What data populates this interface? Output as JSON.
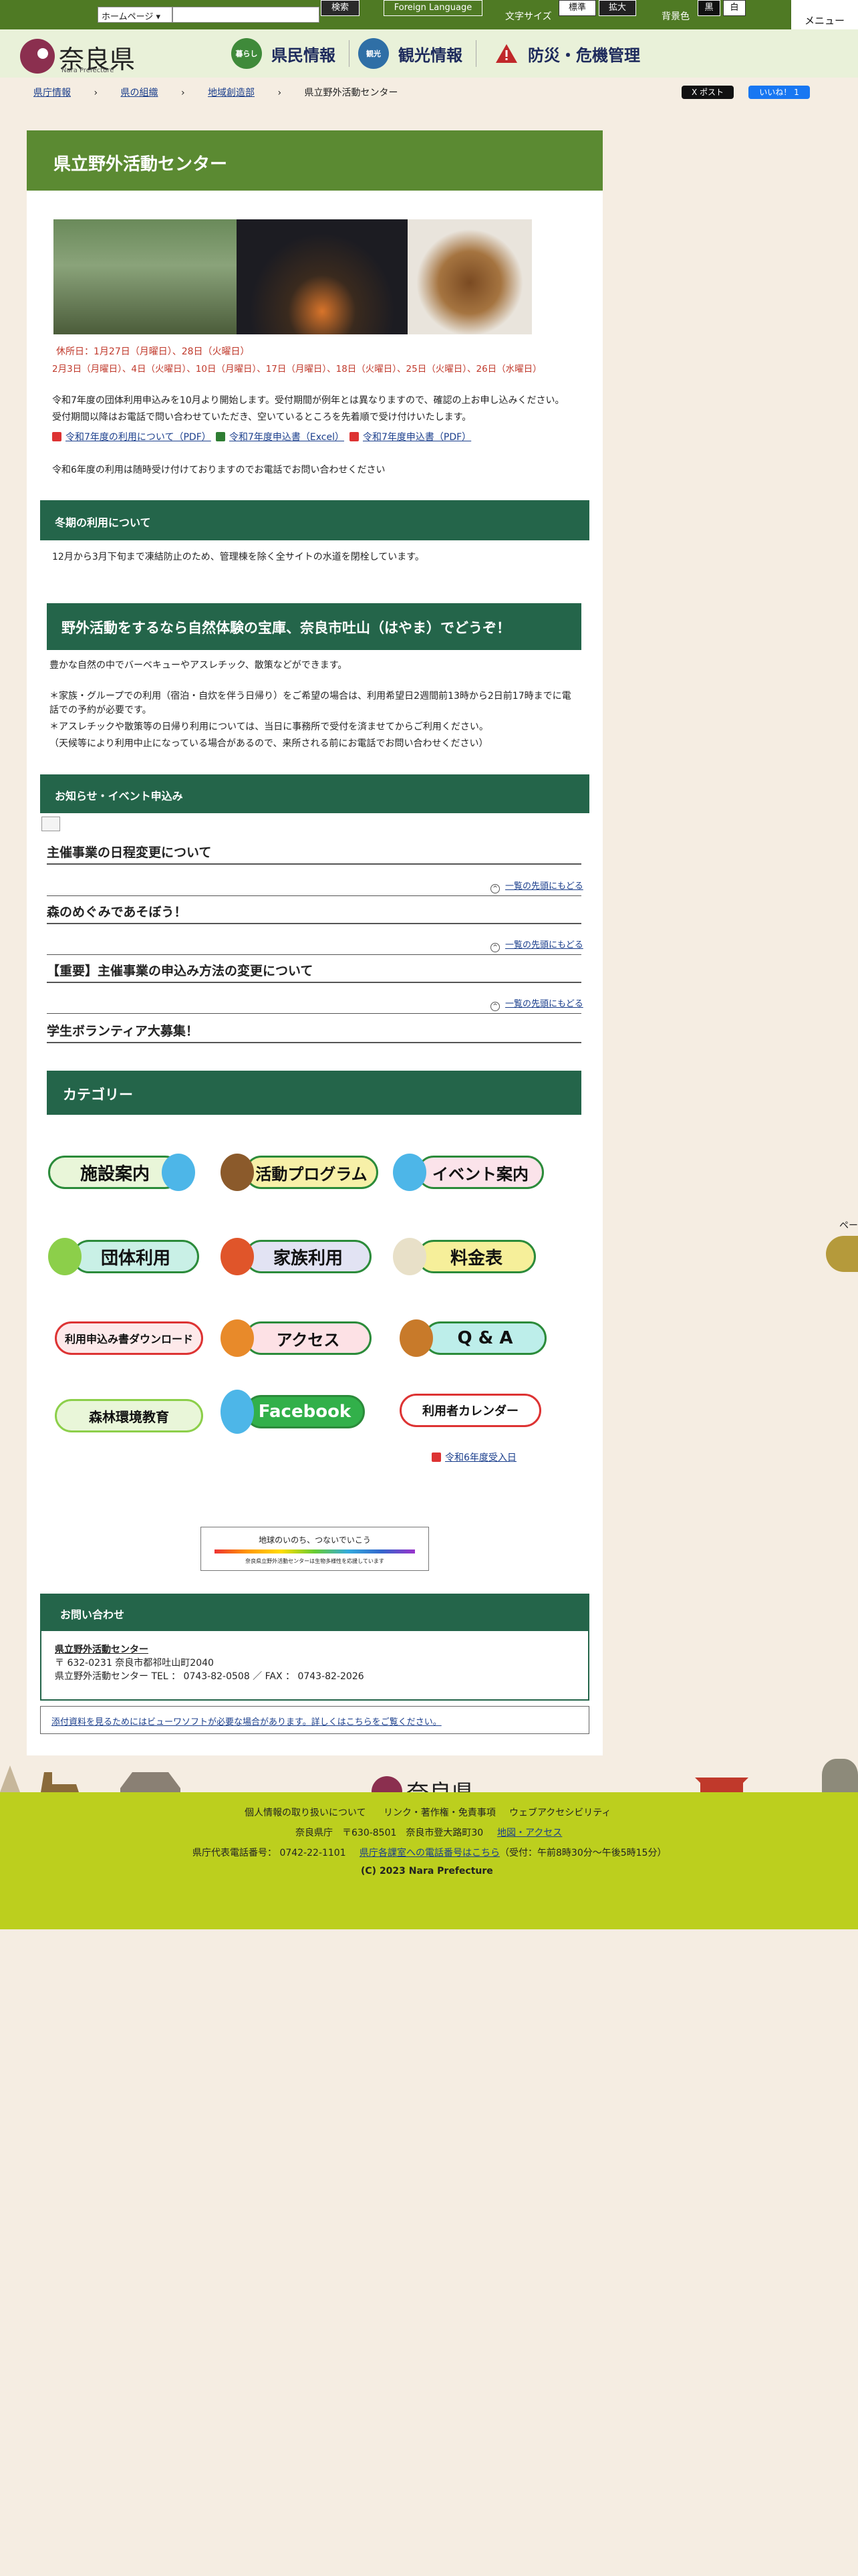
{
  "topbar": {
    "select_value": "ホームページ",
    "search_btn": "検索",
    "foreign": "Foreign Language",
    "fontsize_label": "文字サイズ",
    "fontsize_std": "標準",
    "fontsize_big": "拡大",
    "bg_label": "背景色",
    "bg_black": "黒",
    "bg_white": "白",
    "menu": "メニュー"
  },
  "logo": {
    "name": "奈良県",
    "sub": "Nara Prefecture"
  },
  "nav": [
    {
      "icon": "暮らし",
      "label": "県民情報",
      "color": "#3f8a3a"
    },
    {
      "icon": "観光",
      "label": "観光情報",
      "color": "#2f6fa6"
    },
    {
      "icon": "!",
      "label": "防災・危機管理",
      "color": "#c0282a"
    }
  ],
  "breadcrumb": [
    "県庁情報",
    "県の組織",
    "地域創造部",
    "県立野外活動センター"
  ],
  "share": {
    "x": "X ポスト",
    "fb": "いいね！ 1"
  },
  "page": {
    "title": "県立野外活動センター",
    "closed1": "休所日：1月27日（月曜日）、28日（火曜日）",
    "closed2": "2月3日（月曜日）、4日（火曜日）、10日（月曜日）、17日（月曜日）、18日（火曜日）、25日（火曜日）、26日（水曜日）",
    "notice1": "令和7年度の団体利用申込みを10月より開始します。受付期間が例年とは異なりますので、確認の上お申し込みください。",
    "notice2": "受付期間以降はお電話で問い合わせていただき、空いているところを先着順で受け付けいたします。",
    "links": [
      "令和7年度の利用について（PDF）",
      "令和7年度申込書（Excel）",
      "令和7年度申込書（PDF）"
    ],
    "notice3": "令和6年度の利用は随時受け付けておりますのでお電話でお問い合わせください",
    "winter_title": "冬期の利用について",
    "winter_text": "12月から3月下旬まで凍結防止のため、管理棟を除く全サイトの水道を閉栓しています。",
    "promo_title": "野外活動をするなら自然体験の宝庫、奈良市吐山（はやま）でどうぞ！",
    "promo1": "豊かな自然の中でバーベキューやアスレチック、散策などができます。",
    "promo2": "＊家族・グループでの利用（宿泊・自炊を伴う日帰り）をご希望の場合は、利用希望日2週間前13時から2日前17時までに電",
    "promo3": "話での予約が必要です。",
    "promo4": "＊アスレチックや散策等の日帰り利用については、当日に事務所で受付を済ませてからご利用ください。",
    "promo5": "（天候等により利用中止になっている場合があるので、来所される前にお電話でお問い合わせください）",
    "news_title": "お知らせ・イベント申込み",
    "news": [
      "主催事業の日程変更について",
      "森のめぐみであそぼう！",
      "【重要】主催事業の申込み方法の変更について",
      "学生ボランティア大募集！"
    ],
    "to_top": "一覧の先頭にもどる",
    "cat_title": "カテゴリー",
    "categories": [
      "施設案内",
      "活動プログラム",
      "イベント案内",
      "団体利用",
      "家族利用",
      "料金表",
      "利用申込み書ダウンロード",
      "アクセス",
      "Q & A",
      "森林環境教育",
      "Facebook",
      "利用者カレンダー"
    ],
    "cal_link": "令和6年度受入日",
    "banner1": "地球のいのち、つないでいこう",
    "banner2": "奈良県立野外活動センターは生物多様性を応援しています",
    "contact_title": "お問い合わせ",
    "contact_name": "県立野外活動センター",
    "contact_addr": "〒 632-0231 奈良市都祁吐山町2040",
    "contact_tel": "県立野外活動センター TEL ： 0743-82-0508 ／ FAX ： 0743-82-2026",
    "viewer": "添付資料を見るためにはビューワソフトが必要な場合があります。詳しくはこちらをご覧ください。"
  },
  "footer": {
    "links": [
      "個人情報の取り扱いについて",
      "リンク・著作権・免責事項",
      "ウェブアクセシビリティ"
    ],
    "addr": "奈良県庁　〒630-8501　奈良市登大路町30",
    "map": "地図・アクセス",
    "tel": "県庁代表電話番号： 0742-22-1101",
    "phone_link": "県庁各課室への電話番号はこちら",
    "hours": "（受付：午前8時30分～午後5時15分）",
    "copyright": "(C) 2023 Nara Prefecture"
  },
  "side": {
    "label": "ペー"
  }
}
